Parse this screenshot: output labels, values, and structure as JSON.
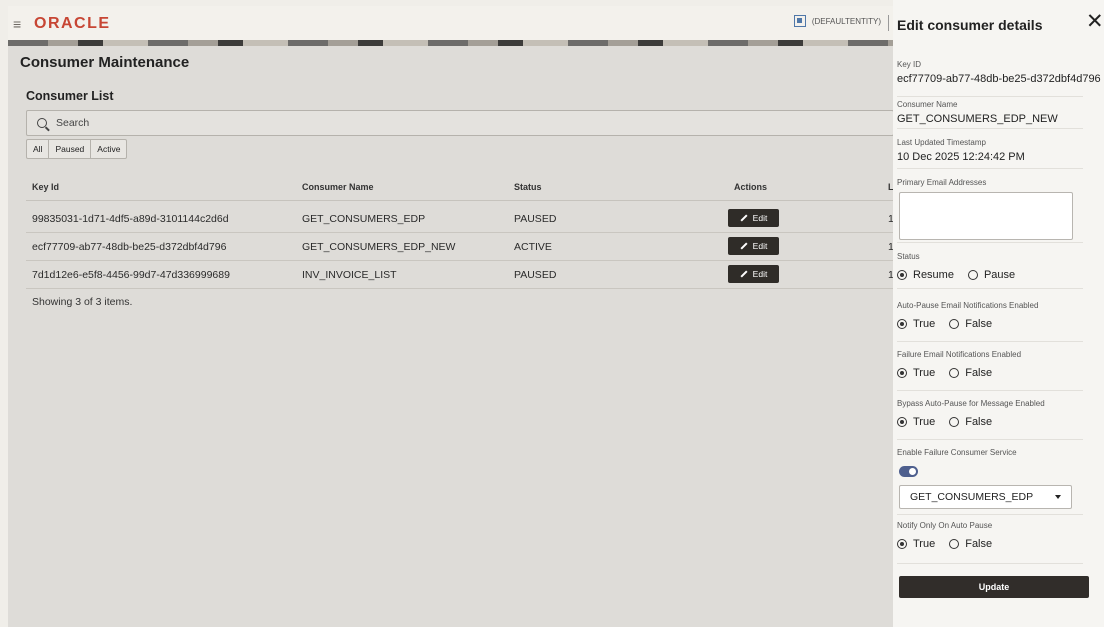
{
  "header": {
    "logo": "ORACLE",
    "entity": "(DEFAULTENTITY)",
    "menu_icon": "hamburger-icon"
  },
  "page": {
    "title": "Consumer Maintenance",
    "list_title": "Consumer List"
  },
  "search": {
    "placeholder": "Search"
  },
  "filters": [
    "All",
    "Paused",
    "Active"
  ],
  "table": {
    "headers": [
      "Key Id",
      "Consumer Name",
      "Status",
      "Actions",
      "L"
    ],
    "rows": [
      {
        "key_id": "99835031-1d71-4df5-a89d-3101144c2d6d",
        "name": "GET_CONSUMERS_EDP",
        "status": "PAUSED",
        "action": "Edit",
        "trail": "1"
      },
      {
        "key_id": "ecf77709-ab77-48db-be25-d372dbf4d796",
        "name": "GET_CONSUMERS_EDP_NEW",
        "status": "ACTIVE",
        "action": "Edit",
        "trail": "1"
      },
      {
        "key_id": "7d1d12e6-e5f8-4456-99d7-47d336999689",
        "name": "INV_INVOICE_LIST",
        "status": "PAUSED",
        "action": "Edit",
        "trail": "1"
      }
    ],
    "count_text": "Showing 3 of 3 items."
  },
  "panel": {
    "title": "Edit consumer details",
    "key_id_label": "Key ID",
    "key_id": "ecf77709-ab77-48db-be25-d372dbf4d796",
    "consumer_name_label": "Consumer Name",
    "consumer_name": "GET_CONSUMERS_EDP_NEW",
    "timestamp_label": "Last Updated Timestamp",
    "timestamp": "10 Dec 2025 12:24:42 PM",
    "email_label": "Primary Email Addresses",
    "email_value": "",
    "status_label": "Status",
    "status_options": [
      "Resume",
      "Pause"
    ],
    "auto_pause_label": "Auto-Pause Email Notifications Enabled",
    "failure_label": "Failure Email Notifications Enabled",
    "bypass_label": "Bypass Auto-Pause for Message Enabled",
    "enable_failure_label": "Enable Failure Consumer Service",
    "enable_failure_on": true,
    "failure_service": "GET_CONSUMERS_EDP",
    "notify_label": "Notify Only On Auto Pause",
    "true_label": "True",
    "false_label": "False",
    "update_label": "Update"
  },
  "colors": {
    "brand": "#c74634",
    "dark_button": "#2f2c28",
    "toggle": "#4e5f8e"
  }
}
